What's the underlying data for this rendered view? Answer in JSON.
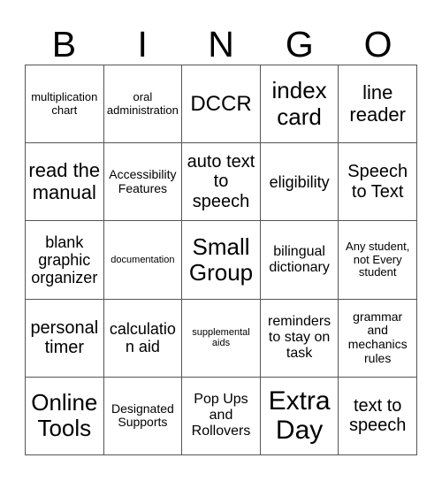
{
  "card": {
    "header_letters": [
      "B",
      "I",
      "N",
      "G",
      "O"
    ],
    "colors": {
      "background": "#ffffff",
      "text": "#000000",
      "grid_line": "#555555"
    },
    "grid": {
      "columns": 5,
      "rows": 5,
      "cells": [
        {
          "text": "multiplication chart",
          "size": "fs-13"
        },
        {
          "text": "oral administration",
          "size": "fs-13"
        },
        {
          "text": "DCCR",
          "size": "fs-24"
        },
        {
          "text": "index card",
          "size": "fs-26"
        },
        {
          "text": "line reader",
          "size": "fs-22"
        },
        {
          "text": "read the manual",
          "size": "fs-22"
        },
        {
          "text": "Accessibility Features",
          "size": "fs-14"
        },
        {
          "text": "auto text to speech",
          "size": "fs-20"
        },
        {
          "text": "eligibility",
          "size": "fs-18"
        },
        {
          "text": "Speech to Text",
          "size": "fs-20"
        },
        {
          "text": "blank graphic organizer",
          "size": "fs-18"
        },
        {
          "text": "documentation",
          "size": "fs-11"
        },
        {
          "text": "Small Group",
          "size": "fs-26"
        },
        {
          "text": "bilingual dictionary",
          "size": "fs-16"
        },
        {
          "text": "Any student, not Every student",
          "size": "fs-13"
        },
        {
          "text": "personal timer",
          "size": "fs-20"
        },
        {
          "text": "calculation aid",
          "size": "fs-18"
        },
        {
          "text": "supplemental aids",
          "size": "fs-11"
        },
        {
          "text": "reminders to stay on task",
          "size": "fs-16"
        },
        {
          "text": "grammar and mechanics rules",
          "size": "fs-14"
        },
        {
          "text": "Online Tools",
          "size": "fs-26"
        },
        {
          "text": "Designated Supports",
          "size": "fs-14"
        },
        {
          "text": "Pop Ups and Rollovers",
          "size": "fs-16"
        },
        {
          "text": "Extra Day",
          "size": "fs-30"
        },
        {
          "text": "text to speech",
          "size": "fs-20"
        }
      ]
    }
  }
}
